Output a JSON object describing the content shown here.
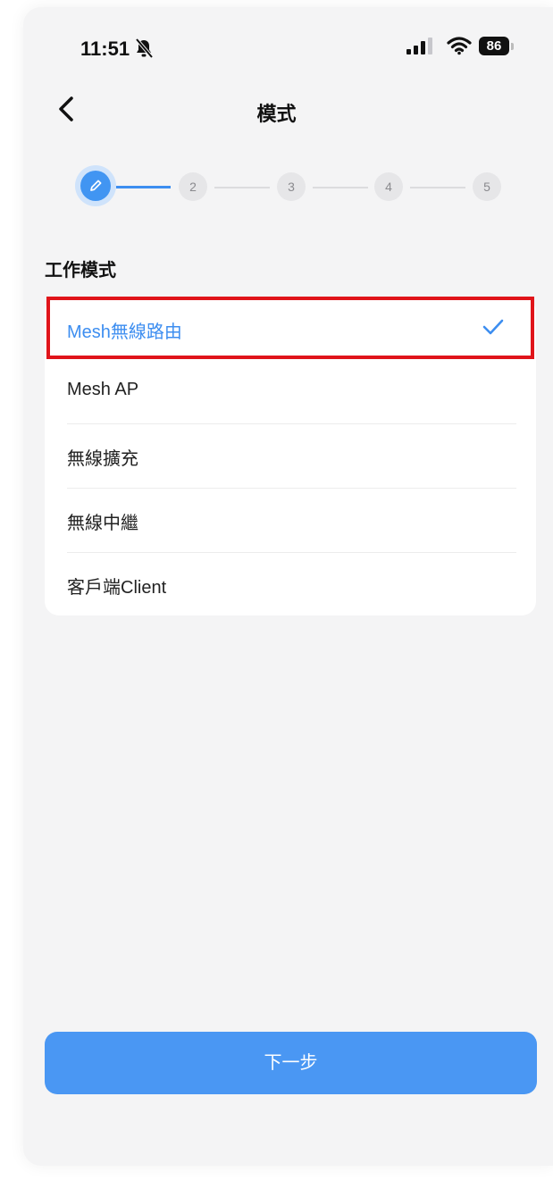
{
  "status_bar": {
    "time": "11:51",
    "battery": "86"
  },
  "header": {
    "title": "模式"
  },
  "stepper": {
    "steps": [
      "2",
      "3",
      "4",
      "5"
    ]
  },
  "section": {
    "label": "工作模式"
  },
  "modes": [
    {
      "label": "Mesh無線路由",
      "selected": true
    },
    {
      "label": "Mesh AP"
    },
    {
      "label": "無線擴充"
    },
    {
      "label": "無線中繼"
    },
    {
      "label": "客戶端Client"
    }
  ],
  "footer": {
    "next_label": "下一步"
  },
  "colors": {
    "accent": "#3d8ef0",
    "highlight": "#e0141a",
    "background": "#f4f4f5"
  }
}
